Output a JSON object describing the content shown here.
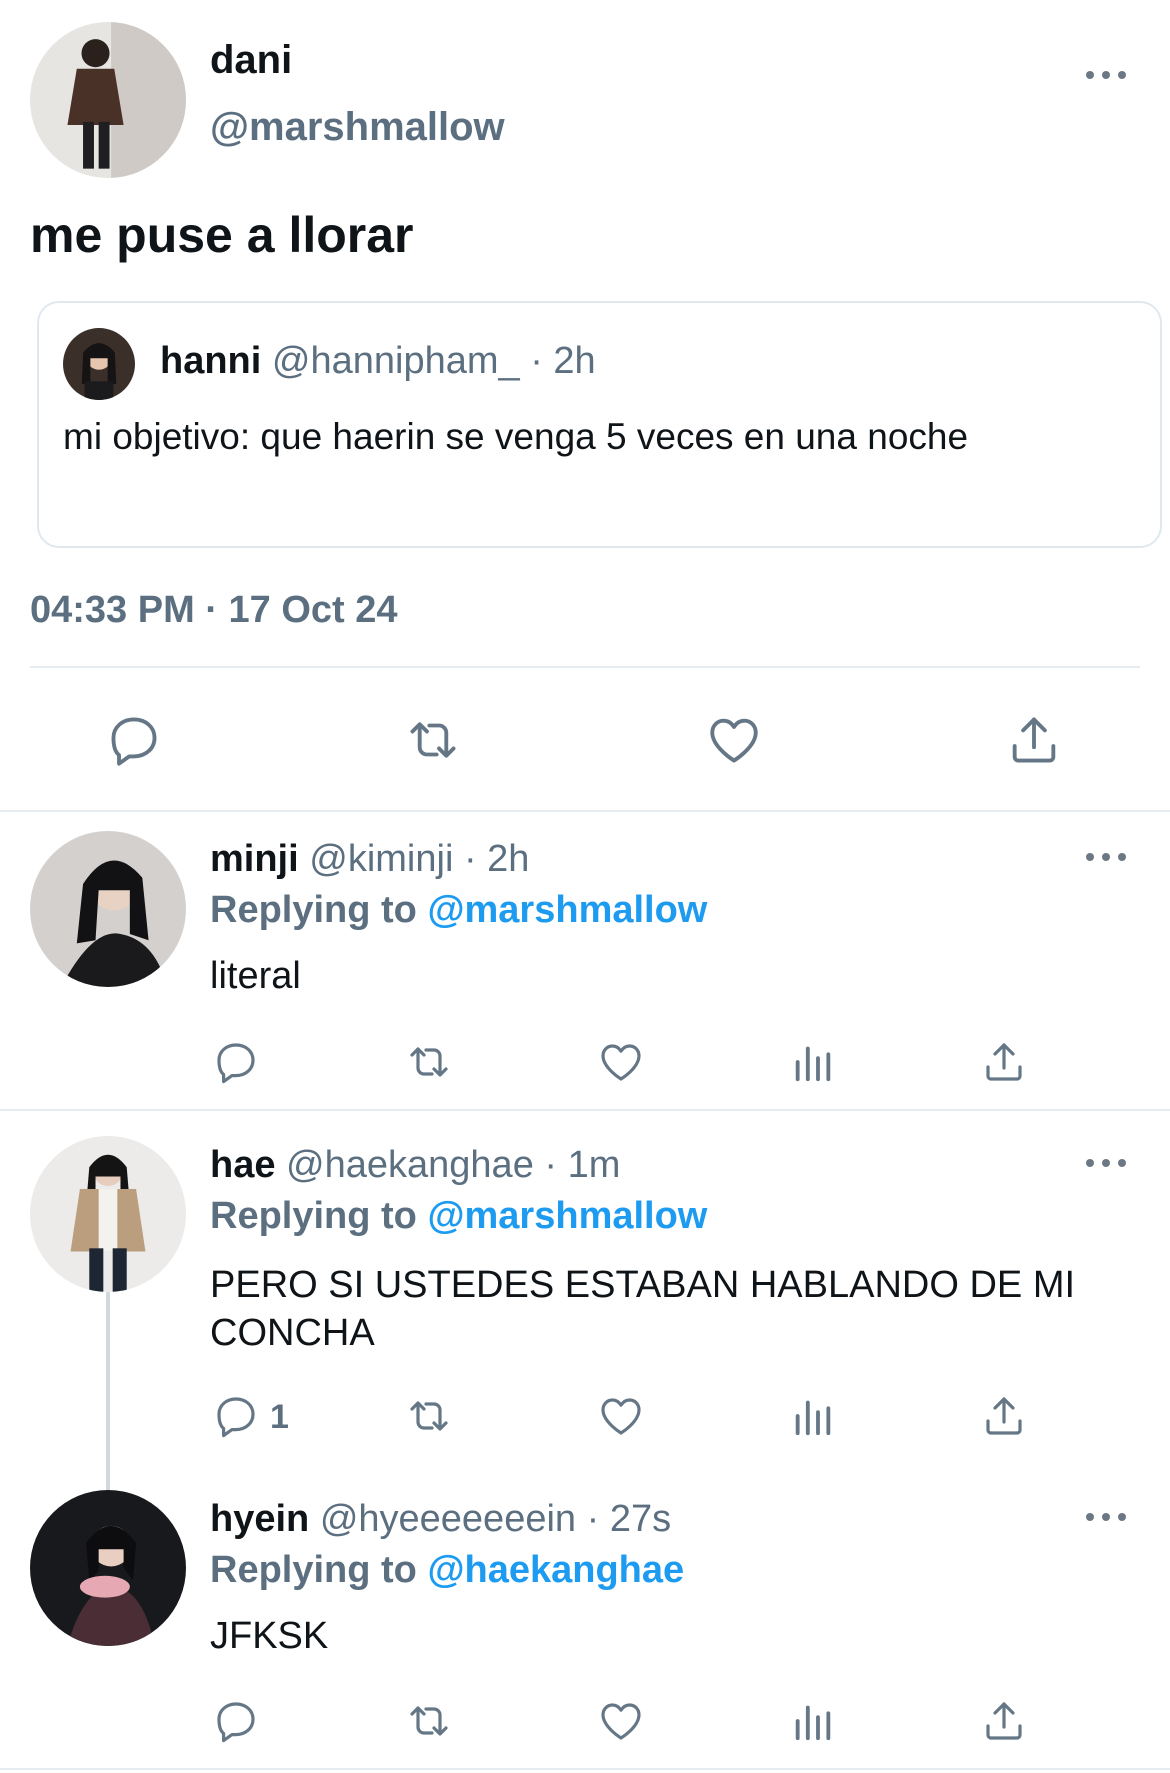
{
  "main_tweet": {
    "display_name": "dani",
    "handle": "@marshmallow",
    "text": "me puse a llorar",
    "timestamp": "04:33 PM · 17 Oct 24",
    "quoted": {
      "display_name": "hanni",
      "handle": "@hannipham_",
      "time": "· 2h",
      "text": "mi objetivo: que haerin se venga 5 veces en una noche"
    }
  },
  "replies": [
    {
      "display_name": "minji",
      "handle": "@kiminji",
      "time": "· 2h",
      "replying_prefix": "Replying to",
      "replying_handle": "@marshmallow",
      "text": "literal",
      "reply_count": ""
    },
    {
      "display_name": "hae",
      "handle": "@haekanghae",
      "time": "· 1m",
      "replying_prefix": "Replying to",
      "replying_handle": "@marshmallow",
      "text": "PERO SI USTEDES ESTABAN HABLANDO DE MI CONCHA",
      "reply_count": "1"
    },
    {
      "display_name": "hyein",
      "handle": "@hyeeeeeeein",
      "time": "· 27s",
      "replying_prefix": "Replying to",
      "replying_handle": "@haekanghae",
      "text": "JFKSK",
      "reply_count": ""
    }
  ],
  "colors": {
    "text": "#0f1419",
    "muted": "#5b6f80",
    "accent": "#1d9bf0",
    "icon": "#657786",
    "divider": "#e6ecf0"
  },
  "icons": [
    "more-icon",
    "reply-icon",
    "retweet-icon",
    "like-icon",
    "share-icon",
    "stats-icon"
  ]
}
